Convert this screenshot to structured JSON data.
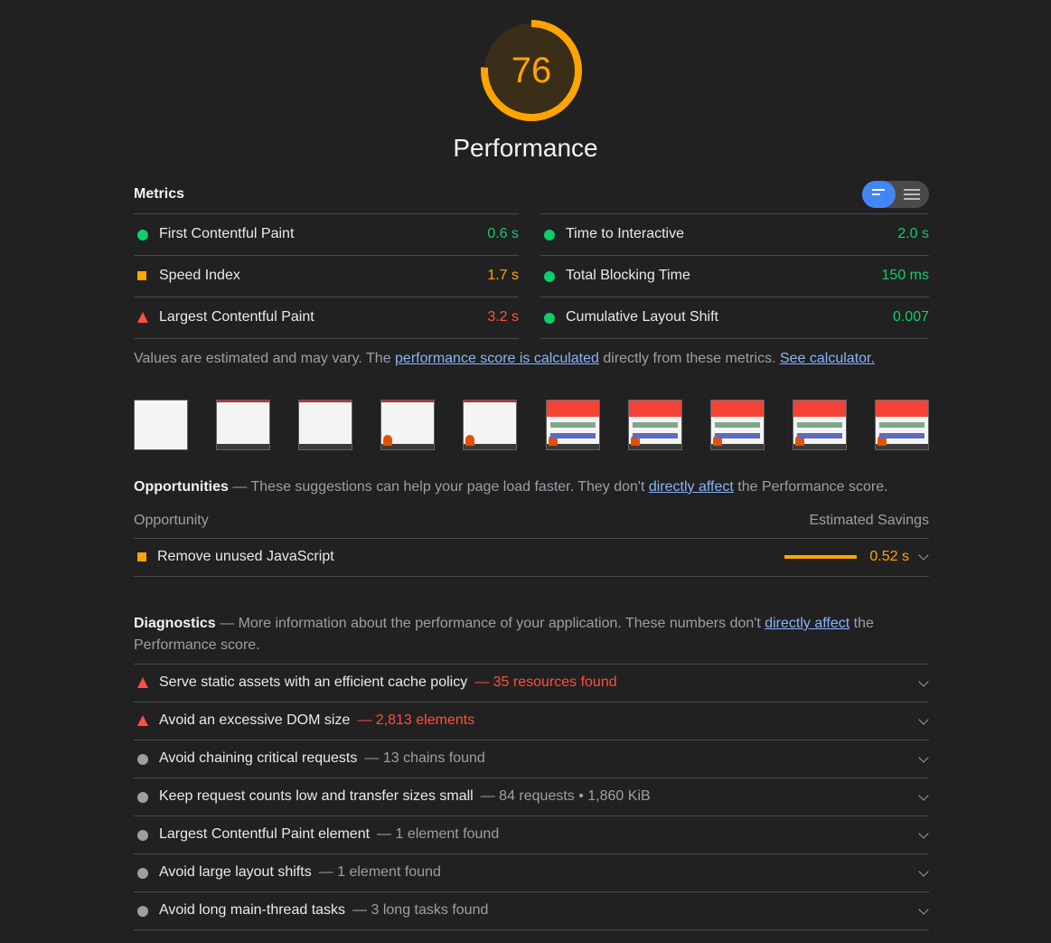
{
  "score": {
    "value": "76",
    "fraction": 0.76,
    "color": "#ffa400"
  },
  "category_title": "Performance",
  "metrics": {
    "title": "Metrics",
    "left": [
      {
        "label": "First Contentful Paint",
        "value": "0.6 s",
        "status": "pass"
      },
      {
        "label": "Speed Index",
        "value": "1.7 s",
        "status": "average"
      },
      {
        "label": "Largest Contentful Paint",
        "value": "3.2 s",
        "status": "fail"
      }
    ],
    "right": [
      {
        "label": "Time to Interactive",
        "value": "2.0 s",
        "status": "pass"
      },
      {
        "label": "Total Blocking Time",
        "value": "150 ms",
        "status": "pass"
      },
      {
        "label": "Cumulative Layout Shift",
        "value": "0.007",
        "status": "pass"
      }
    ]
  },
  "note": {
    "prefix": "Values are estimated and may vary. The ",
    "link1": "performance score is calculated",
    "middle": " directly from these metrics. ",
    "link2": "See calculator."
  },
  "filmstrip": [
    "blank",
    "blank",
    "blank",
    "figure",
    "figure",
    "full",
    "full",
    "full",
    "full",
    "full"
  ],
  "opportunities": {
    "title": "Opportunities",
    "desc_prefix": " — These suggestions can help your page load faster. They don't ",
    "desc_link": "directly affect",
    "desc_suffix": " the Performance score.",
    "col_left": "Opportunity",
    "col_right": "Estimated Savings",
    "items": [
      {
        "label": "Remove unused JavaScript",
        "value": "0.52 s",
        "status": "average"
      }
    ]
  },
  "diagnostics": {
    "title": "Diagnostics",
    "desc_prefix": " — More information about the performance of your application. These numbers don't ",
    "desc_link": "directly affect",
    "desc_suffix": " the Performance score.",
    "items": [
      {
        "label": "Serve static assets with an efficient cache policy",
        "detail": "— 35 resources found",
        "status": "fail"
      },
      {
        "label": "Avoid an excessive DOM size",
        "detail": "— 2,813 elements",
        "status": "fail"
      },
      {
        "label": "Avoid chaining critical requests",
        "detail": "— 13 chains found",
        "status": "info"
      },
      {
        "label": "Keep request counts low and transfer sizes small",
        "detail": "— 84 requests • 1,860 KiB",
        "status": "info"
      },
      {
        "label": "Largest Contentful Paint element",
        "detail": "— 1 element found",
        "status": "info"
      },
      {
        "label": "Avoid large layout shifts",
        "detail": "— 1 element found",
        "status": "info"
      },
      {
        "label": "Avoid long main-thread tasks",
        "detail": "— 3 long tasks found",
        "status": "info"
      }
    ]
  },
  "colors": {
    "pass": "#0cce6b",
    "average": "#ffa400",
    "fail": "#ff4e42",
    "info": "#9e9e9e",
    "link": "#8ab4f8"
  }
}
